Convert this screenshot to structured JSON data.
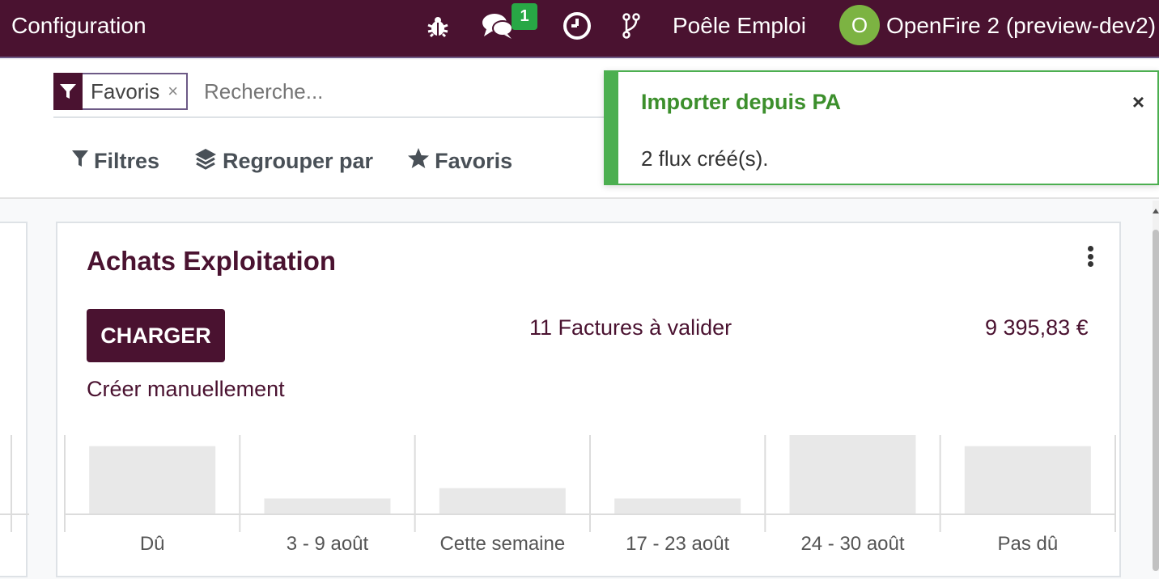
{
  "topbar": {
    "app_title": "Configuration",
    "messages_count": "1",
    "company": "Poêle Emploi",
    "avatar_letter": "O",
    "database": "OpenFire 2 (preview-dev2)"
  },
  "search": {
    "facet_label": "Favoris",
    "facet_close": "×",
    "placeholder": "Recherche..."
  },
  "filters": {
    "filters_label": "Filtres",
    "group_by_label": "Regrouper par",
    "favorites_label": "Favoris"
  },
  "notification": {
    "title": "Importer depuis PA",
    "message": "2 flux créé(s).",
    "close": "×"
  },
  "card": {
    "title": "Achats Exploitation",
    "load_button": "CHARGER",
    "create_manual_link": "Créer manuellement",
    "invoices_to_validate": "11 Factures à valider",
    "amount": "9 395,83 €"
  },
  "colors": {
    "brand": "#4a1230",
    "success": "#4caf50",
    "avatar": "#7cb342"
  },
  "chart_data": {
    "type": "bar",
    "categories": [
      "Dû",
      "3 - 9 août",
      "Cette semaine",
      "17 - 23 août",
      "24 - 30 août",
      "Pas dû"
    ],
    "values": [
      86,
      20,
      33,
      20,
      100,
      86
    ],
    "ylim": [
      0,
      100
    ],
    "grid": false,
    "legend": "none"
  }
}
